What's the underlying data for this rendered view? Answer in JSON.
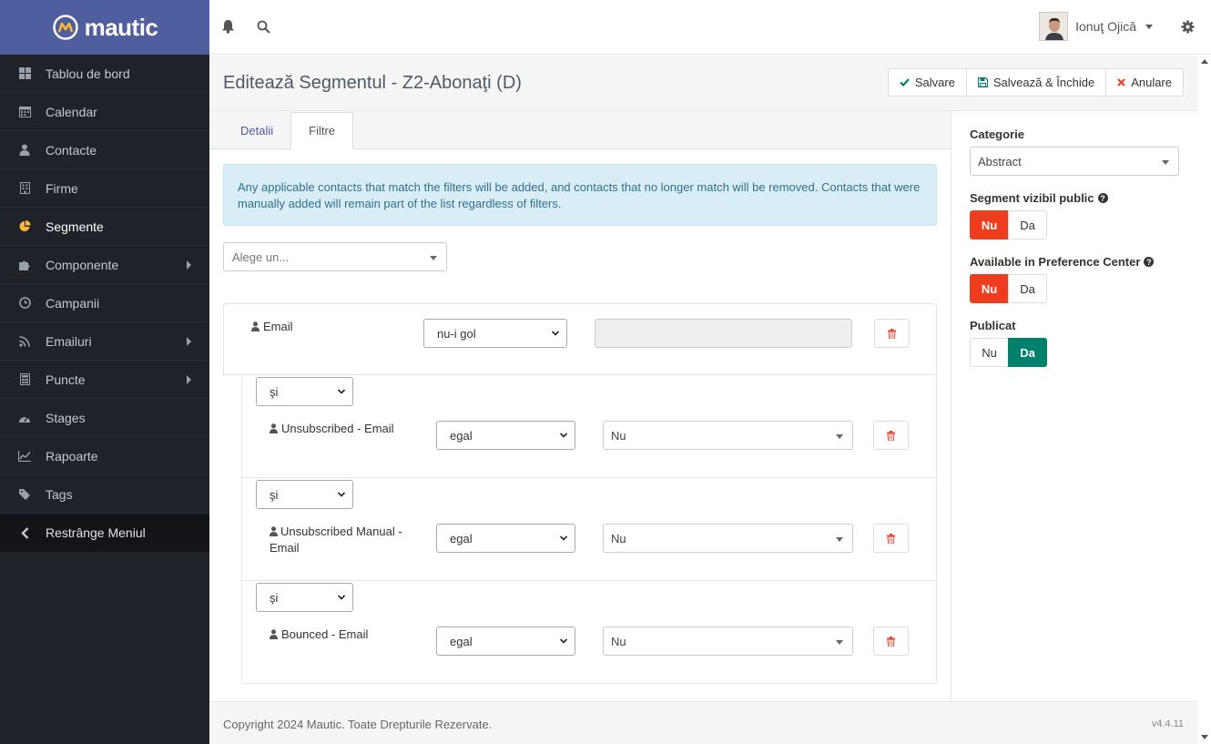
{
  "brand": {
    "name": "mautic"
  },
  "colors": {
    "sidebar": "#1f2228",
    "brand_bar": "#4e5e9e",
    "accent_red": "#f03c1e",
    "accent_green": "#00806d",
    "active_icon": "#fdb933"
  },
  "sidebar": {
    "items": [
      {
        "label": "Tablou de bord",
        "icon": "dashboard-icon",
        "active": false,
        "has_caret": false
      },
      {
        "label": "Calendar",
        "icon": "calendar-icon",
        "active": false,
        "has_caret": false
      },
      {
        "label": "Contacte",
        "icon": "user-icon",
        "active": false,
        "has_caret": false
      },
      {
        "label": "Firme",
        "icon": "building-icon",
        "active": false,
        "has_caret": false
      },
      {
        "label": "Segmente",
        "icon": "pie-chart-icon",
        "active": true,
        "has_caret": false
      },
      {
        "label": "Componente",
        "icon": "puzzle-icon",
        "active": false,
        "has_caret": true
      },
      {
        "label": "Campanii",
        "icon": "clock-icon",
        "active": false,
        "has_caret": false
      },
      {
        "label": "Emailuri",
        "icon": "rss-icon",
        "active": false,
        "has_caret": true
      },
      {
        "label": "Puncte",
        "icon": "calculator-icon",
        "active": false,
        "has_caret": true
      },
      {
        "label": "Stages",
        "icon": "tachometer-icon",
        "active": false,
        "has_caret": false
      },
      {
        "label": "Rapoarte",
        "icon": "line-chart-icon",
        "active": false,
        "has_caret": false
      },
      {
        "label": "Tags",
        "icon": "tag-icon",
        "active": false,
        "has_caret": false
      }
    ],
    "collapse_label": "Restrânge Meniul"
  },
  "topbar": {
    "user_name": "Ionuţ Ojică"
  },
  "header": {
    "title": "Editează Segmentul - Z2-Abonaţi (D)",
    "save_label": "Salvare",
    "save_close_label": "Salvează & Închide",
    "cancel_label": "Anulare"
  },
  "tabs": [
    {
      "label": "Detalii",
      "active": false
    },
    {
      "label": "Filtre",
      "active": true
    }
  ],
  "filters": {
    "info": "Any applicable contacts that match the filters will be added, and contacts that no longer match will be removed. Contacts that were manually added will remain part of the list regardless of filters.",
    "choose_placeholder": "Alege un...",
    "first": {
      "field": "Email",
      "operator": "nu-i gol"
    },
    "rows": [
      {
        "glue": "şi",
        "field": "Unsubscribed - Email",
        "operator": "egal",
        "value": "Nu"
      },
      {
        "glue": "şi",
        "field": "Unsubscribed Manual - Email",
        "operator": "egal",
        "value": "Nu"
      },
      {
        "glue": "şi",
        "field": "Bounced - Email",
        "operator": "egal",
        "value": "Nu"
      }
    ]
  },
  "right_panel": {
    "category_label": "Categorie",
    "category_value": "Abstract",
    "public_label": "Segment vizibil public",
    "public_no": "Nu",
    "public_yes": "Da",
    "pref_label": "Available in Preference Center",
    "pref_no": "Nu",
    "pref_yes": "Da",
    "published_label": "Publicat",
    "published_no": "Nu",
    "published_yes": "Da"
  },
  "footer": {
    "copyright": "Copyright 2024 Mautic. Toate Drepturile Rezervate.",
    "version": "v4.4.11"
  }
}
